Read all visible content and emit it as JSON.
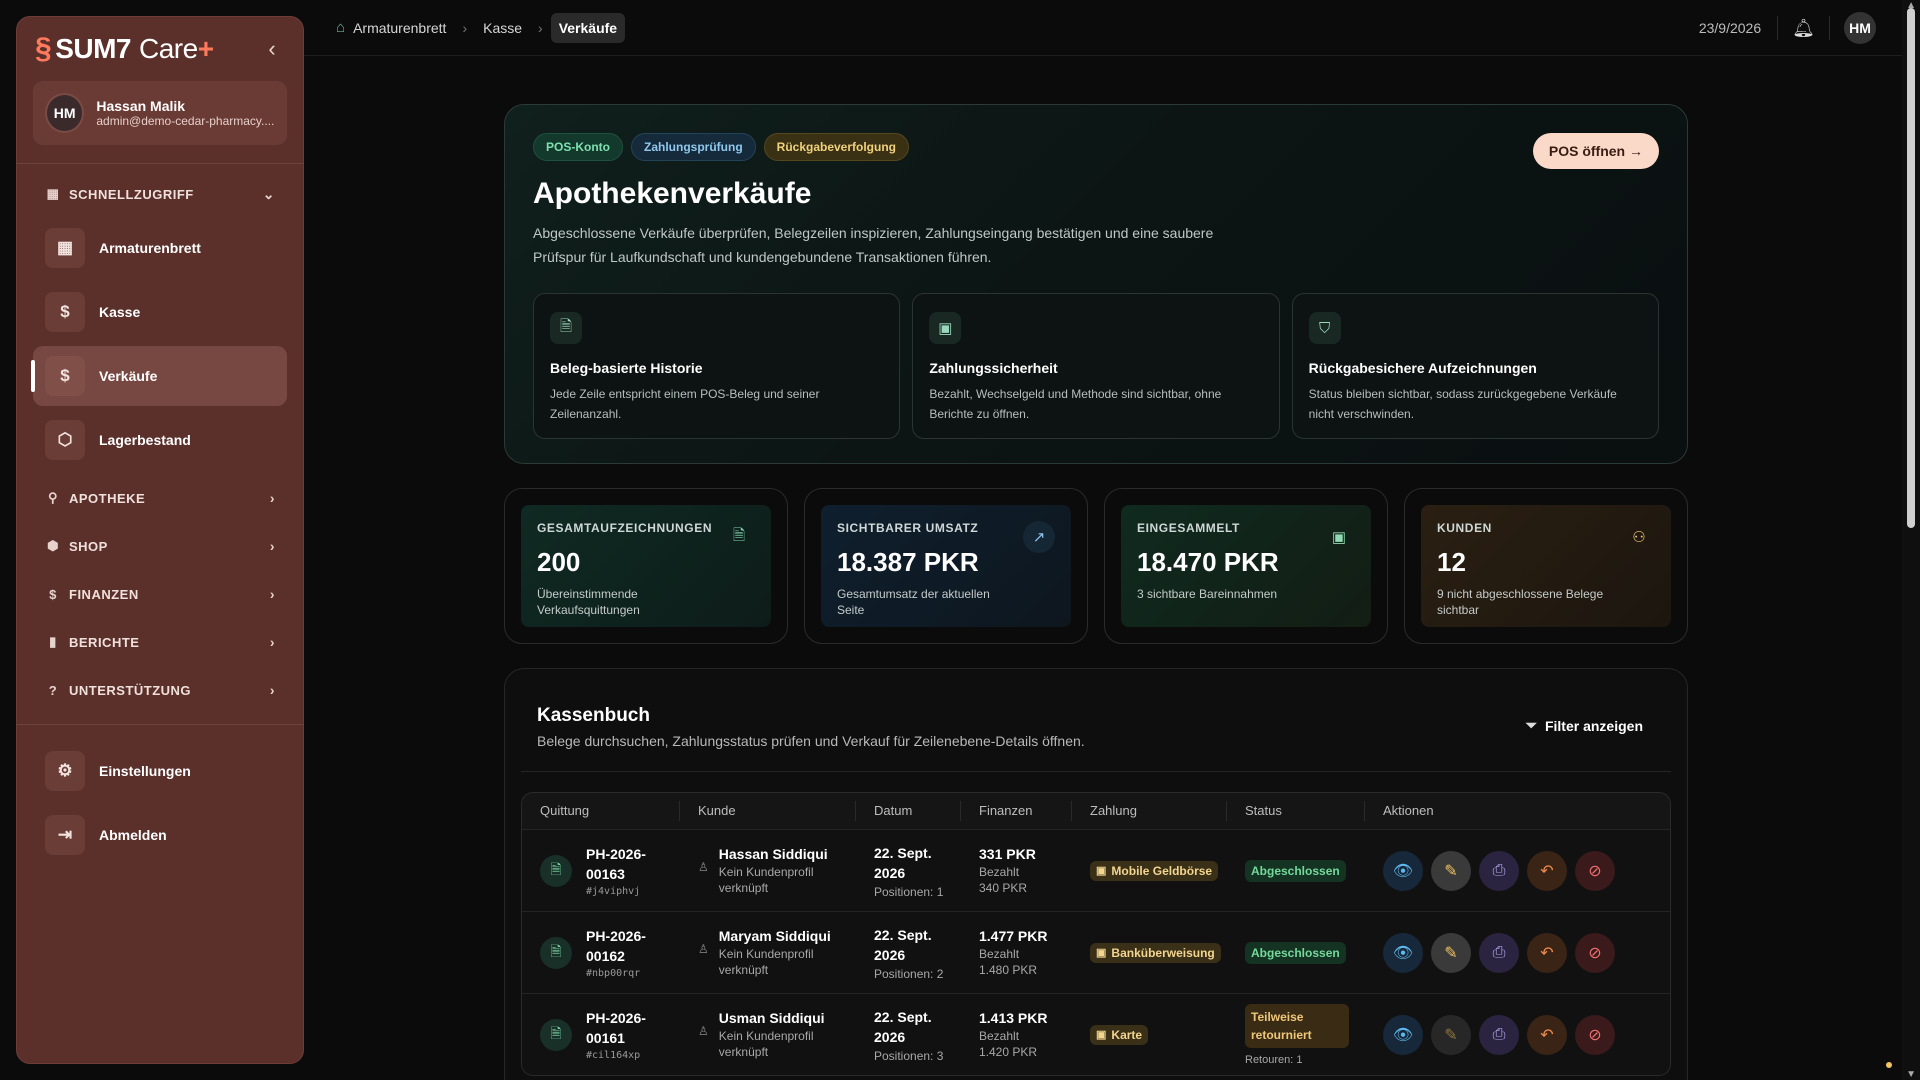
{
  "sidebar": {
    "brand_name": "SUM7",
    "brand_product": "Care",
    "brand_plus": "+",
    "user": {
      "initials": "HM",
      "name": "Hassan Malik",
      "email": "admin@demo-cedar-pharmacy...."
    },
    "quick_access_label": "SCHNELLZUGRIFF",
    "quick_items": [
      {
        "label": "Armaturenbrett",
        "icon": "grid-icon"
      },
      {
        "label": "Kasse",
        "icon": "cash-register-icon"
      },
      {
        "label": "Verkäufe",
        "icon": "dollar-icon",
        "active": true
      },
      {
        "label": "Lagerbestand",
        "icon": "box-icon"
      }
    ],
    "sections": [
      {
        "label": "APOTHEKE",
        "icon": "pill-icon"
      },
      {
        "label": "SHOP",
        "icon": "shop-icon"
      },
      {
        "label": "FINANZEN",
        "icon": "dollar-icon"
      },
      {
        "label": "BERICHTE",
        "icon": "bar-chart-icon"
      },
      {
        "label": "UNTERSTÜTZUNG",
        "icon": "help-icon"
      }
    ],
    "bottom_items": [
      {
        "label": "Einstellungen",
        "icon": "gear-icon"
      },
      {
        "label": "Abmelden",
        "icon": "logout-icon"
      }
    ]
  },
  "topbar": {
    "breadcrumbs": [
      "Armaturenbrett",
      "Kasse",
      "Verkäufe"
    ],
    "date": "23/9/2026",
    "avatar": "HM"
  },
  "hero": {
    "chips": [
      "POS-Konto",
      "Zahlungsprüfung",
      "Rückgabeverfolgung"
    ],
    "pos_button": "POS öffnen",
    "title": "Apothekenverkäufe",
    "description": "Abgeschlossene Verkäufe überprüfen, Belegzeilen inspizieren, Zahlungseingang bestätigen und eine saubere Prüfspur für Laufkundschaft und kundengebundene Transaktionen führen.",
    "features": [
      {
        "title": "Beleg-basierte Historie",
        "desc": "Jede Zeile entspricht einem POS-Beleg und seiner Zeilenanzahl."
      },
      {
        "title": "Zahlungssicherheit",
        "desc": "Bezahlt, Wechselgeld und Methode sind sichtbar, ohne Berichte zu öffnen."
      },
      {
        "title": "Rückgabesichere Aufzeichnungen",
        "desc": "Status bleiben sichtbar, sodass zurückgegebene Verkäufe nicht verschwinden."
      }
    ]
  },
  "stats": [
    {
      "label": "GESAMTAUFZEICHNUNGEN",
      "value": "200",
      "sub": "Übereinstimmende Verkaufsquittungen",
      "color": "#0f2a22"
    },
    {
      "label": "SICHTBARER UMSATZ",
      "value": "18.387 PKR",
      "sub": "Gesamtumsatz der aktuellen Seite",
      "color": "#0f1f2e"
    },
    {
      "label": "EINGESAMMELT",
      "value": "18.470 PKR",
      "sub": "3 sichtbare Bareinnahmen",
      "color": "#0f2a1f"
    },
    {
      "label": "KUNDEN",
      "value": "12",
      "sub": "9 nicht abgeschlossene Belege sichtbar",
      "color": "#2a1f12"
    }
  ],
  "ledger": {
    "title": "Kassenbuch",
    "subtitle": "Belege durchsuchen, Zahlungsstatus prüfen und Verkauf für Zeilenebene-Details öffnen.",
    "filter_label": "Filter anzeigen",
    "columns": [
      "Quittung",
      "Kunde",
      "Datum",
      "Finanzen",
      "Zahlung",
      "Status",
      "Aktionen"
    ],
    "rows": [
      {
        "receipt": "PH-2026-00163",
        "hash": "#j4viphvj",
        "customer": "Hassan Siddiqui",
        "customer_note": "Kein Kundenprofil verknüpft",
        "date": "22. Sept. 2026",
        "positions": "Positionen: 1",
        "amount": "331 PKR",
        "paid_label": "Bezahlt",
        "paid": "340 PKR",
        "payment": "Mobile Geldbörse",
        "status": "Abgeschlossen",
        "status_note": ""
      },
      {
        "receipt": "PH-2026-00162",
        "hash": "#nbp00rqr",
        "customer": "Maryam Siddiqui",
        "customer_note": "Kein Kundenprofil verknüpft",
        "date": "22. Sept. 2026",
        "positions": "Positionen: 2",
        "amount": "1.477 PKR",
        "paid_label": "Bezahlt",
        "paid": "1.480 PKR",
        "payment": "Banküberweisung",
        "status": "Abgeschlossen",
        "status_note": ""
      },
      {
        "receipt": "PH-2026-00161",
        "hash": "#cil164xp",
        "customer": "Usman Siddiqui",
        "customer_note": "Kein Kundenprofil verknüpft",
        "date": "22. Sept. 2026",
        "positions": "Positionen: 3",
        "amount": "1.413 PKR",
        "paid_label": "Bezahlt",
        "paid": "1.420 PKR",
        "payment": "Karte",
        "status": "Teilweise retourniert",
        "status_note": "Retouren: 1"
      }
    ]
  }
}
